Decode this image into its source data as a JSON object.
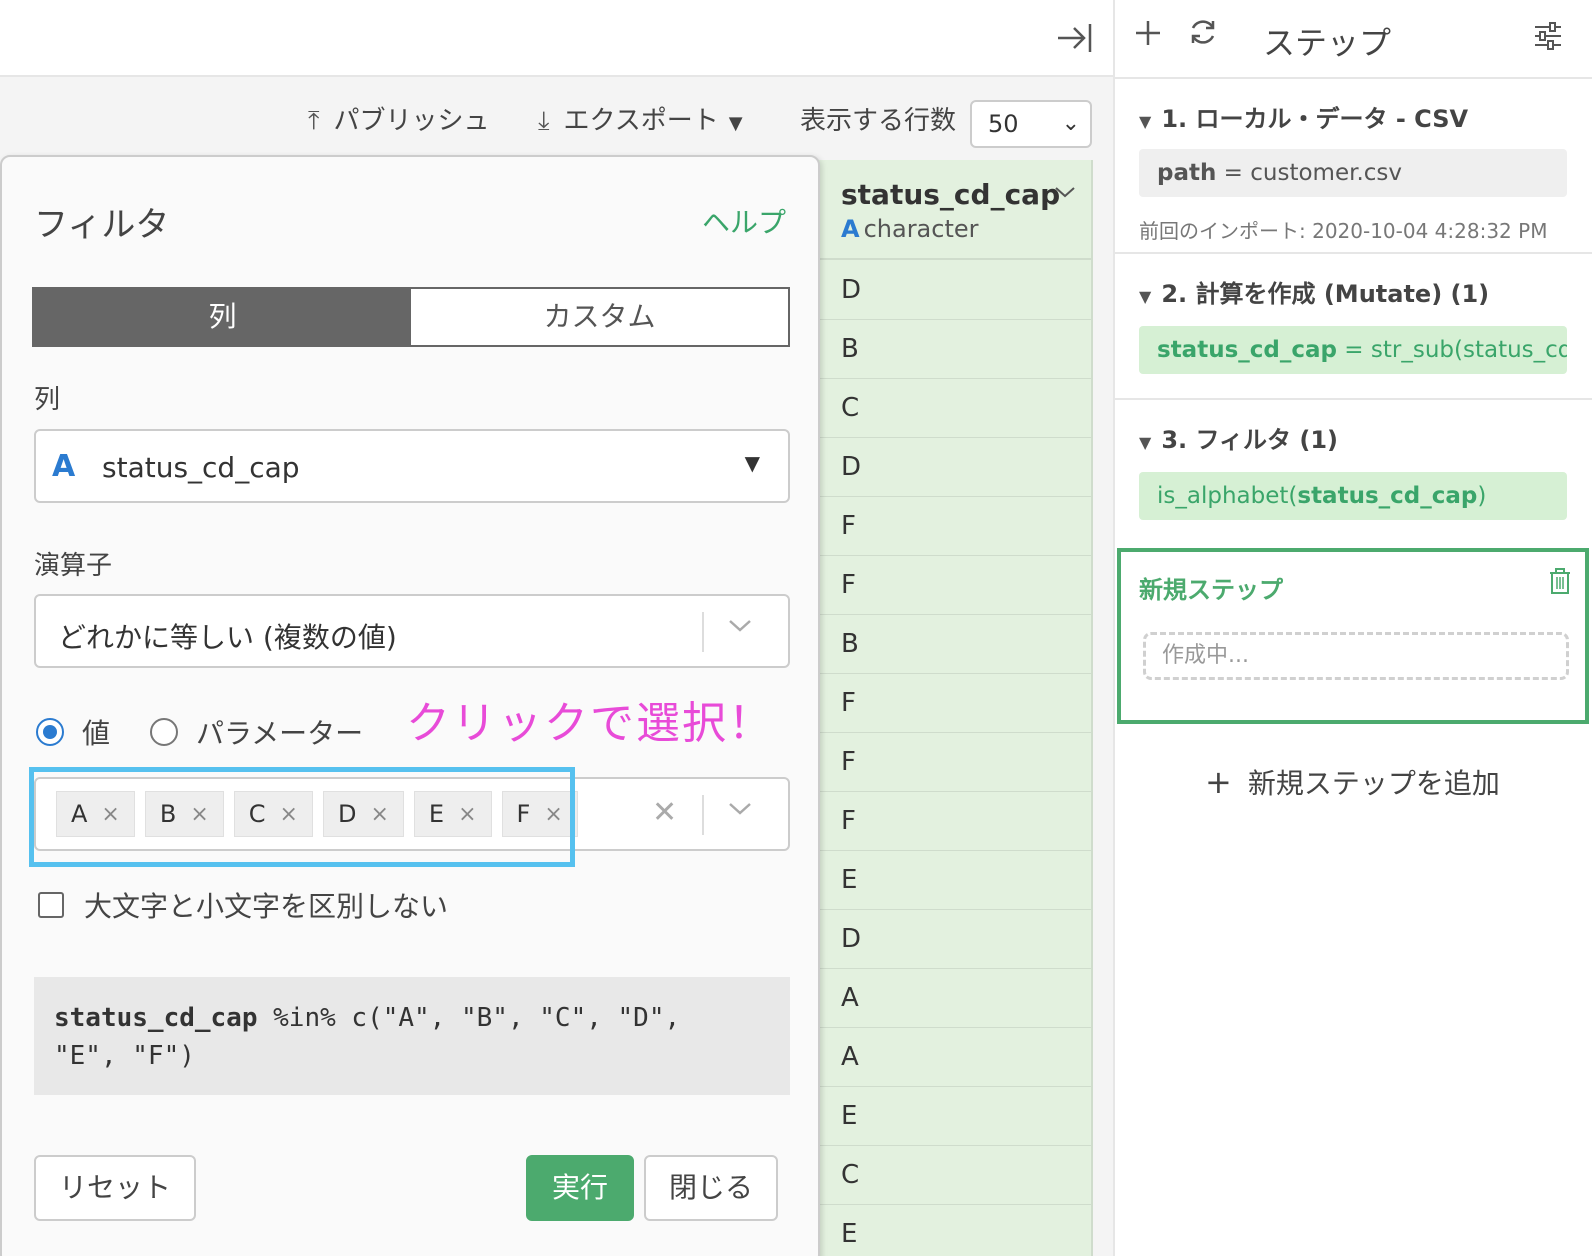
{
  "toolbar": {
    "publish_label": "パブリッシュ",
    "export_label": "エクスポート",
    "rows_label": "表示する行数",
    "rows_value": "50"
  },
  "column": {
    "name": "status_cd_cap",
    "type_icon": "A",
    "type": "character",
    "cells": [
      "D",
      "B",
      "C",
      "D",
      "F",
      "F",
      "B",
      "F",
      "F",
      "F",
      "E",
      "D",
      "A",
      "A",
      "E",
      "C",
      "E"
    ]
  },
  "dialog": {
    "title": "フィルタ",
    "help": "ヘルプ",
    "tab_column": "列",
    "tab_custom": "カスタム",
    "column_label": "列",
    "column_type_icon": "A",
    "column_value": "status_cd_cap",
    "operator_label": "演算子",
    "operator_value": "どれかに等しい (複数の値)",
    "radio_value": "値",
    "radio_param": "パラメーター",
    "annotation": "クリックで選択！",
    "values": [
      "A",
      "B",
      "C",
      "D",
      "E",
      "F"
    ],
    "tag_remove": "×",
    "clear_icon": "✕",
    "case_label": "大文字と小文字を区別しない",
    "code_col": "status_cd_cap",
    "code_rest": " %in% c(\"A\", \"B\", \"C\", \"D\",",
    "code_line2": "\"E\", \"F\")",
    "reset": "リセット",
    "run": "実行",
    "close": "閉じる"
  },
  "steps": {
    "title": "ステップ",
    "items": [
      {
        "title": "1. ローカル・データ - CSV",
        "body_key": "path",
        "body_rest": " = customer.csv",
        "meta": "前回のインポート: 2020-10-04 4:28:32 PM"
      },
      {
        "title": "2. 計算を作成 (Mutate) (1)",
        "body_key": "status_cd_cap",
        "body_rest": " = str_sub(status_cd…"
      },
      {
        "title": "3. フィルタ (1)",
        "body_pre": "is_alphabet(",
        "body_key": "status_cd_cap",
        "body_post": ")"
      }
    ],
    "new_step_title": "新規ステップ",
    "new_step_placeholder": "作成中...",
    "add_new_step": "新規ステップを追加"
  },
  "icons": {
    "collapse": "collapse-panel-icon",
    "publish": "upload-icon",
    "export": "download-icon",
    "add": "plus-icon",
    "refresh": "refresh-icon",
    "settings": "sliders-icon",
    "trash": "trash-icon"
  },
  "colors": {
    "accent_green": "#4caa6e",
    "column_bg": "#e3f1df",
    "highlight_blue": "#56c1ef",
    "annotation_pink": "#e84bd8",
    "type_blue": "#2b7bd0"
  }
}
